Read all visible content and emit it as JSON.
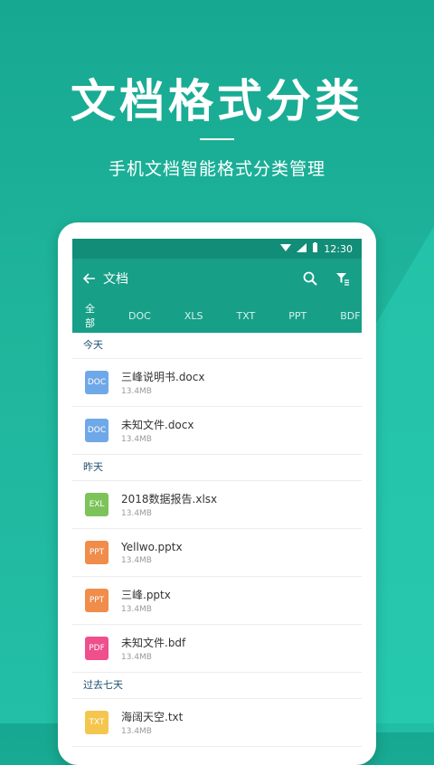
{
  "promo": {
    "title": "文档格式分类",
    "subtitle": "手机文档智能格式分类管理"
  },
  "status_bar": {
    "time": "12:30"
  },
  "app_bar": {
    "title": "文档"
  },
  "tabs": [
    {
      "label": "全部",
      "active": true
    },
    {
      "label": "DOC"
    },
    {
      "label": "XLS"
    },
    {
      "label": "TXT"
    },
    {
      "label": "PPT"
    },
    {
      "label": "BDF"
    }
  ],
  "sections": [
    {
      "header": "今天",
      "files": [
        {
          "badge": "DOC",
          "name": "三峰说明书.docx",
          "size": "13.4MB",
          "color": "#6fa8e8"
        },
        {
          "badge": "DOC",
          "name": "未知文件.docx",
          "size": "13.4MB",
          "color": "#6fa8e8"
        }
      ]
    },
    {
      "header": "昨天",
      "files": [
        {
          "badge": "EXL",
          "name": "2018数据报告.xlsx",
          "size": "13.4MB",
          "color": "#7cc35a"
        },
        {
          "badge": "PPT",
          "name": "Yellwo.pptx",
          "size": "13.4MB",
          "color": "#f08d4b"
        },
        {
          "badge": "PPT",
          "name": "三峰.pptx",
          "size": "13.4MB",
          "color": "#f08d4b"
        },
        {
          "badge": "PDF",
          "name": "未知文件.bdf",
          "size": "13.4MB",
          "color": "#ef4f8c"
        }
      ]
    },
    {
      "header": "过去七天",
      "files": [
        {
          "badge": "TXT",
          "name": "海阔天空.txt",
          "size": "13.4MB",
          "color": "#f4c64e"
        }
      ]
    }
  ],
  "colors": {
    "primary": "#179f88",
    "status": "#128d78"
  }
}
